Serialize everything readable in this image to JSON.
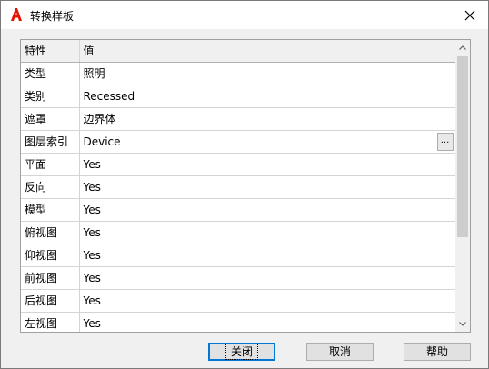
{
  "window": {
    "title": "转换样板"
  },
  "grid": {
    "headers": {
      "property": "特性",
      "value": "值"
    },
    "rows": [
      {
        "name": "类型",
        "value": "照明"
      },
      {
        "name": "类别",
        "value": "Recessed"
      },
      {
        "name": "遮罩",
        "value": "边界体"
      },
      {
        "name": "图层索引",
        "value": "Device",
        "browse": "..."
      },
      {
        "name": "平面",
        "value": "Yes"
      },
      {
        "name": "反向",
        "value": "Yes"
      },
      {
        "name": "模型",
        "value": "Yes"
      },
      {
        "name": "俯视图",
        "value": "Yes"
      },
      {
        "name": "仰视图",
        "value": "Yes"
      },
      {
        "name": "前视图",
        "value": "Yes"
      },
      {
        "name": "后视图",
        "value": "Yes"
      },
      {
        "name": "左视图",
        "value": "Yes"
      }
    ]
  },
  "buttons": {
    "close": "关闭",
    "cancel": "取消",
    "help": "帮助"
  },
  "icons": {
    "app": "autocad-a-icon",
    "close": "close-icon",
    "scroll_up": "chevron-up-icon",
    "scroll_down": "chevron-down-icon"
  },
  "colors": {
    "app_icon_red": "#e51400",
    "focus_blue": "#0078d7"
  }
}
